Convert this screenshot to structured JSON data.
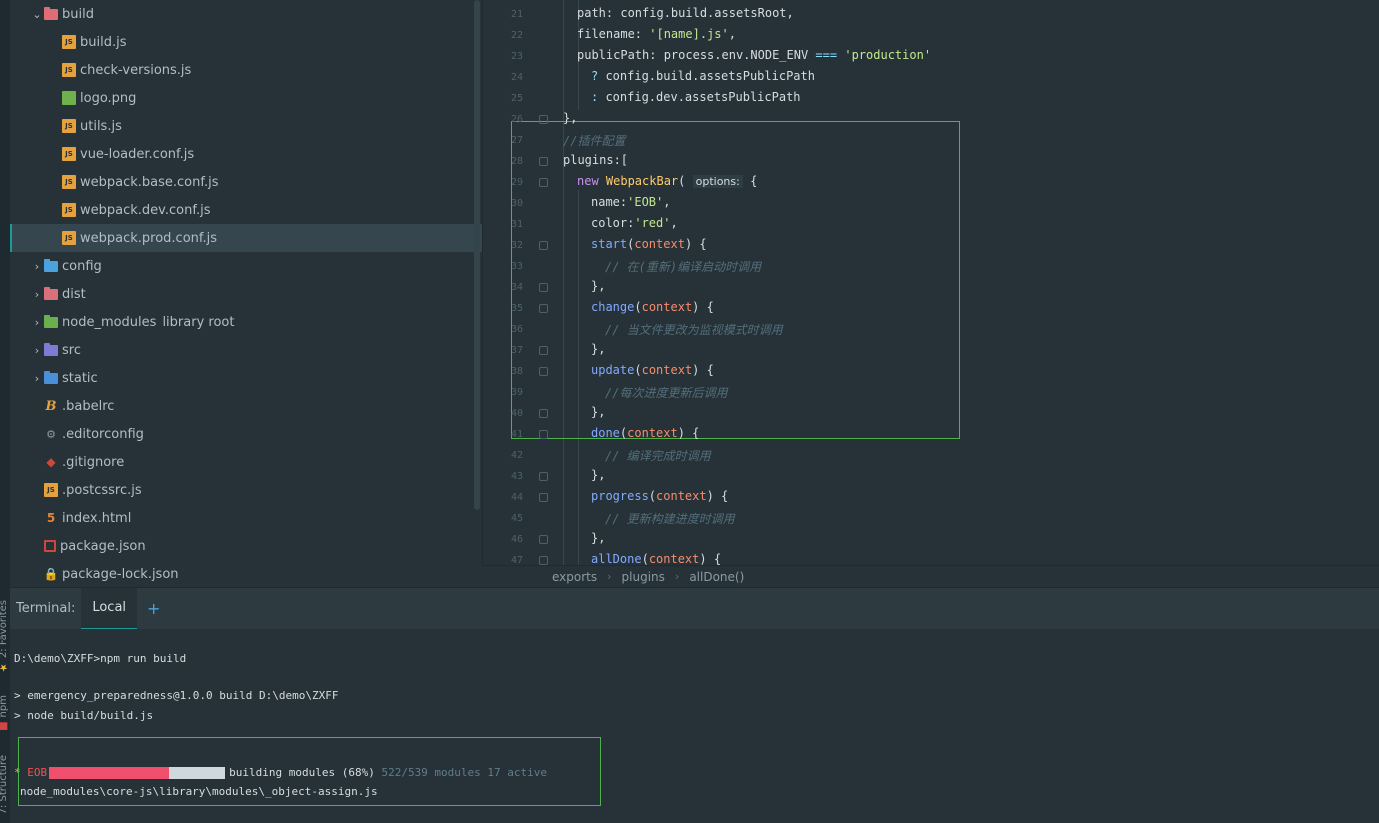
{
  "side_tabs": {
    "favorites": "2: Favorites",
    "npm": "npm",
    "structure": "7: Structure"
  },
  "project_tree": [
    {
      "label": "build",
      "kind": "folder",
      "color": "#e06c75",
      "expanded": true,
      "depth": 1
    },
    {
      "label": "build.js",
      "kind": "js",
      "depth": 2
    },
    {
      "label": "check-versions.js",
      "kind": "js",
      "depth": 2
    },
    {
      "label": "logo.png",
      "kind": "png",
      "depth": 2
    },
    {
      "label": "utils.js",
      "kind": "js",
      "depth": 2
    },
    {
      "label": "vue-loader.conf.js",
      "kind": "js",
      "depth": 2
    },
    {
      "label": "webpack.base.conf.js",
      "kind": "js",
      "depth": 2
    },
    {
      "label": "webpack.dev.conf.js",
      "kind": "js",
      "depth": 2
    },
    {
      "label": "webpack.prod.conf.js",
      "kind": "js",
      "depth": 2,
      "selected": true
    },
    {
      "label": "config",
      "kind": "folder",
      "color": "#4aa3df",
      "depth": 1
    },
    {
      "label": "dist",
      "kind": "folder",
      "color": "#d9707a",
      "depth": 1
    },
    {
      "label": "node_modules",
      "suffix": "library root",
      "kind": "folder",
      "color": "#6ab04c",
      "depth": 1
    },
    {
      "label": "src",
      "kind": "folder",
      "color": "#7c7bd6",
      "depth": 1
    },
    {
      "label": "static",
      "kind": "folder",
      "color": "#4a90d9",
      "depth": 1
    },
    {
      "label": ".babelrc",
      "kind": "babel",
      "depth": 1
    },
    {
      "label": ".editorconfig",
      "kind": "cfg",
      "depth": 1
    },
    {
      "label": ".gitignore",
      "kind": "git",
      "depth": 1
    },
    {
      "label": ".postcssrc.js",
      "kind": "js",
      "depth": 1
    },
    {
      "label": "index.html",
      "kind": "html5",
      "depth": 1
    },
    {
      "label": "package.json",
      "kind": "pkg",
      "depth": 1
    },
    {
      "label": "package-lock.json",
      "kind": "lock",
      "depth": 1
    }
  ],
  "editor": {
    "lines": [
      {
        "n": "21",
        "indent": 2,
        "segs": [
          [
            "",
            "path: config.build.assetsRoot,"
          ]
        ]
      },
      {
        "n": "22",
        "indent": 2,
        "segs": [
          [
            "",
            "filename: "
          ],
          [
            "s",
            "'[name].js'"
          ],
          [
            "",
            ","
          ]
        ]
      },
      {
        "n": "23",
        "indent": 2,
        "segs": [
          [
            "",
            "publicPath: process.env.NODE_ENV "
          ],
          [
            "op",
            "==="
          ],
          [
            "",
            " "
          ],
          [
            "s",
            "'production'"
          ]
        ]
      },
      {
        "n": "24",
        "indent": 3,
        "segs": [
          [
            "op",
            "? "
          ],
          [
            "",
            "config.build.assetsPublicPath"
          ]
        ]
      },
      {
        "n": "25",
        "indent": 3,
        "segs": [
          [
            "op",
            ": "
          ],
          [
            "",
            "config.dev.assetsPublicPath"
          ]
        ]
      },
      {
        "n": "26",
        "indent": 1,
        "segs": [
          [
            "",
            "},"
          ]
        ]
      },
      {
        "n": "27",
        "indent": 1,
        "segs": [
          [
            "c",
            "//插件配置"
          ]
        ]
      },
      {
        "n": "28",
        "indent": 1,
        "segs": [
          [
            "",
            "plugins:["
          ]
        ]
      },
      {
        "n": "29",
        "indent": 2,
        "segs": [
          [
            "k",
            "new "
          ],
          [
            "cls",
            "WebpackBar"
          ],
          [
            "",
            "( "
          ],
          [
            "hint",
            "options:"
          ],
          [
            "",
            " {"
          ]
        ]
      },
      {
        "n": "30",
        "indent": 3,
        "segs": [
          [
            "",
            "name:"
          ],
          [
            "s",
            "'EOB'"
          ],
          [
            "",
            ","
          ]
        ]
      },
      {
        "n": "31",
        "indent": 3,
        "segs": [
          [
            "",
            "color:"
          ],
          [
            "s",
            "'red'"
          ],
          [
            "",
            ","
          ]
        ]
      },
      {
        "n": "32",
        "indent": 3,
        "segs": [
          [
            "f",
            "start"
          ],
          [
            "",
            "("
          ],
          [
            "p",
            "context"
          ],
          [
            "",
            ") {"
          ]
        ]
      },
      {
        "n": "33",
        "indent": 4,
        "segs": [
          [
            "c",
            "// 在(重新)编译启动时调用"
          ]
        ]
      },
      {
        "n": "34",
        "indent": 3,
        "segs": [
          [
            "",
            "},"
          ]
        ]
      },
      {
        "n": "35",
        "indent": 3,
        "segs": [
          [
            "f",
            "change"
          ],
          [
            "",
            "("
          ],
          [
            "p",
            "context"
          ],
          [
            "",
            ") {"
          ]
        ]
      },
      {
        "n": "36",
        "indent": 4,
        "segs": [
          [
            "c",
            "// 当文件更改为监视模式时调用"
          ]
        ]
      },
      {
        "n": "37",
        "indent": 3,
        "segs": [
          [
            "",
            "},"
          ]
        ]
      },
      {
        "n": "38",
        "indent": 3,
        "segs": [
          [
            "f",
            "update"
          ],
          [
            "",
            "("
          ],
          [
            "p",
            "context"
          ],
          [
            "",
            ") {"
          ]
        ]
      },
      {
        "n": "39",
        "indent": 4,
        "segs": [
          [
            "c",
            "//每次进度更新后调用"
          ]
        ]
      },
      {
        "n": "40",
        "indent": 3,
        "segs": [
          [
            "",
            "},"
          ]
        ]
      },
      {
        "n": "41",
        "indent": 3,
        "segs": [
          [
            "f",
            "done"
          ],
          [
            "",
            "("
          ],
          [
            "p",
            "context"
          ],
          [
            "",
            ") {"
          ]
        ]
      },
      {
        "n": "42",
        "indent": 4,
        "segs": [
          [
            "c",
            "// 编译完成时调用"
          ]
        ]
      },
      {
        "n": "43",
        "indent": 3,
        "segs": [
          [
            "",
            "},"
          ]
        ]
      },
      {
        "n": "44",
        "indent": 3,
        "segs": [
          [
            "f",
            "progress"
          ],
          [
            "",
            "("
          ],
          [
            "p",
            "context"
          ],
          [
            "",
            ") {"
          ]
        ]
      },
      {
        "n": "45",
        "indent": 4,
        "segs": [
          [
            "c",
            "// 更新构建进度时调用"
          ]
        ]
      },
      {
        "n": "46",
        "indent": 3,
        "segs": [
          [
            "",
            "},"
          ]
        ]
      },
      {
        "n": "47",
        "indent": 3,
        "segs": [
          [
            "f",
            "allDone"
          ],
          [
            "",
            "("
          ],
          [
            "p",
            "context"
          ],
          [
            "",
            ") {"
          ]
        ]
      }
    ]
  },
  "breadcrumb": [
    "exports",
    "plugins",
    "allDone()"
  ],
  "terminal": {
    "title": "Terminal:",
    "tab_label": "Local",
    "add_label": "+",
    "prompt": "D:\\demo\\ZXFF>npm run build",
    "out1": "> emergency_preparedness@1.0.0 build D:\\demo\\ZXFF",
    "out2": "> node build/build.js",
    "bar_star": "*",
    "bar_name": "EOB",
    "bar_status": "building modules (68%)",
    "bar_progress": 0.68,
    "bar_counts": "522/539 modules 17 active",
    "bar_file": "node_modules\\core-js\\library\\modules\\_object-assign.js"
  }
}
